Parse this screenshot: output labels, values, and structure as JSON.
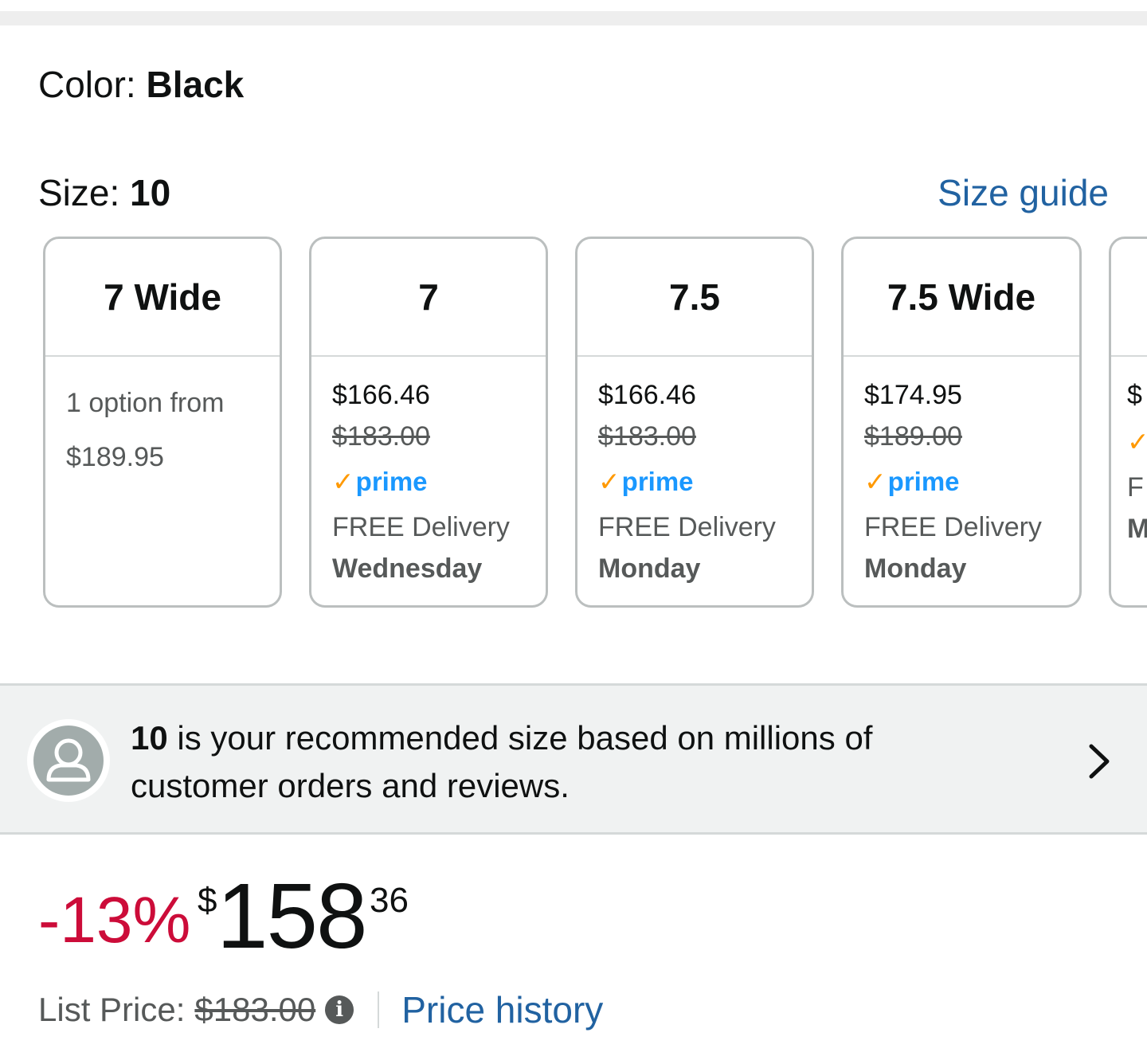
{
  "color": {
    "label": "Color:",
    "value": "Black"
  },
  "size": {
    "label": "Size:",
    "value": "10",
    "guide_link": "Size guide"
  },
  "size_cards": [
    {
      "size": "7 Wide",
      "option_text": "1 option from",
      "option_price": "$189.95"
    },
    {
      "size": "7",
      "price": "$166.46",
      "list_price": "$183.00",
      "prime": "prime",
      "delivery": "FREE Delivery",
      "day": "Wednesday"
    },
    {
      "size": "7.5",
      "price": "$166.46",
      "list_price": "$183.00",
      "prime": "prime",
      "delivery": "FREE Delivery",
      "day": "Monday"
    },
    {
      "size": "7.5 Wide",
      "price": "$174.95",
      "list_price": "$189.00",
      "prime": "prime",
      "delivery": "FREE Delivery",
      "day": "Monday"
    },
    {
      "size": "",
      "price": "$",
      "delivery": "F",
      "day": "M"
    }
  ],
  "recommendation": {
    "size": "10",
    "text": " is your recommended size based on millions of customer orders and reviews."
  },
  "pricing": {
    "discount": "-13%",
    "currency": "$",
    "whole": "158",
    "fraction": "36",
    "list_label": "List Price:",
    "list_price": "$183.00",
    "history_link": "Price history"
  },
  "icons": {
    "prime_check": "checkmark-icon",
    "avatar": "user-avatar-icon",
    "chevron": "chevron-right-icon",
    "info": "info-icon"
  },
  "colors": {
    "link": "#2162a1",
    "discount": "#cc0c39",
    "prime": "#1a98ff",
    "prime_check": "#ff9900"
  }
}
